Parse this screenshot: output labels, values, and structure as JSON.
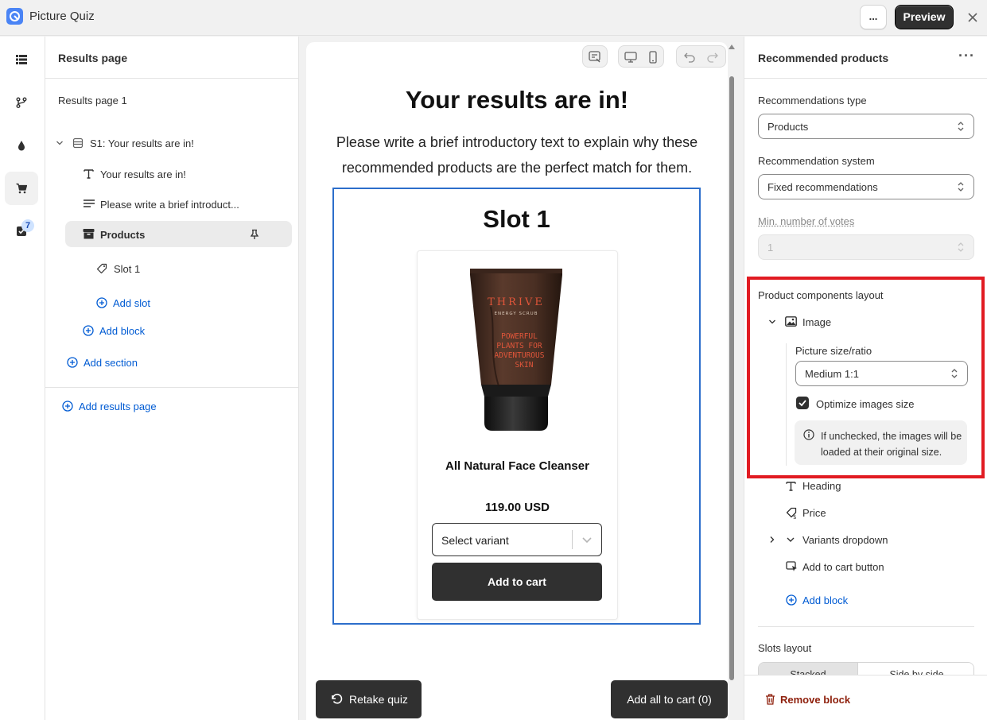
{
  "app": {
    "title": "Picture Quiz",
    "more_label": "...",
    "preview_label": "Preview"
  },
  "rail": {
    "badge_count": "7",
    "icons": [
      "grid-icon",
      "branch-icon",
      "drop-icon",
      "cart-icon",
      "checklist-icon"
    ]
  },
  "left_panel": {
    "heading": "Results page",
    "page_item": "Results page 1",
    "section_label": "S1: Your results are in!",
    "block_heading": "Your results are in!",
    "block_text": "Please write a brief introduct...",
    "block_products": "Products",
    "slot_label": "Slot 1",
    "add_slot": "Add slot",
    "add_block": "Add block",
    "add_section": "Add section",
    "add_results_page": "Add results page"
  },
  "canvas": {
    "title": "Your results are in!",
    "intro": "Please write a brief introductory text to explain why these recommended products are the perfect match for them.",
    "slot_title": "Slot 1",
    "product": {
      "name": "All Natural Face Cleanser",
      "price": "119.00 USD",
      "variant_placeholder": "Select variant",
      "add_to_cart": "Add to cart",
      "image_lettering": {
        "brand": "THRIVE",
        "line1": "ENERGY SCRUB",
        "line2": "POWERFUL",
        "line3": "PLANTS FOR",
        "line4": "ADVENTUROUS",
        "line5": "SKIN"
      }
    },
    "retake_label": "Retake quiz",
    "add_all_label": "Add all to cart (0)"
  },
  "right_panel": {
    "heading": "Recommended products",
    "menu_label": "···",
    "rec_type_label": "Recommendations type",
    "rec_type_value": "Products",
    "rec_system_label": "Recommendation system",
    "rec_system_value": "Fixed recommendations",
    "min_votes_label": "Min. number of votes",
    "min_votes_value": "1",
    "layout_label": "Product components layout",
    "image_label": "Image",
    "picture_size_label": "Picture size/ratio",
    "picture_size_value": "Medium 1:1",
    "optimize_label": "Optimize images size",
    "optimize_checked": true,
    "info_text": "If unchecked, the images will be loaded at their original size.",
    "heading_item": "Heading",
    "price_item": "Price",
    "variants_item": "Variants dropdown",
    "add_to_cart_item": "Add to cart button",
    "add_block": "Add block",
    "slots_layout_label": "Slots layout",
    "slots_options": [
      "Stacked",
      "Side by side"
    ],
    "remove_block": "Remove block"
  },
  "colors": {
    "accent_blue": "#005bd3",
    "highlight_red": "#e11b22",
    "dark_button": "#303030",
    "slot_border": "#2c6ecb"
  }
}
